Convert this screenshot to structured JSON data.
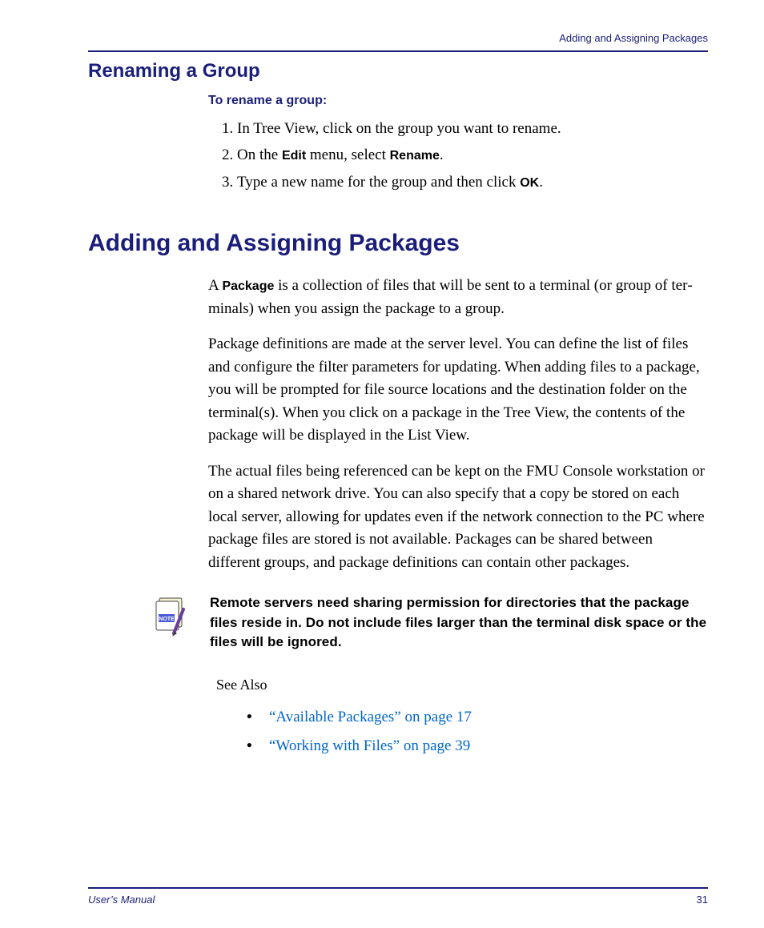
{
  "running_head": "Adding and Assigning Packages",
  "section1": {
    "title": "Renaming a Group",
    "procedure_head": "To rename a group:",
    "step1_pre": "In Tree View, click on the group you want to rename.",
    "step2_pre": "On the ",
    "step2_ui1": "Edit",
    "step2_mid": " menu, select ",
    "step2_ui2": "Rename",
    "step2_post": ".",
    "step3_pre": "Type a new name for the group and then click ",
    "step3_ui1": "OK",
    "step3_post": "."
  },
  "section2": {
    "title": "Adding and Assigning Packages",
    "p1_pre": "A ",
    "p1_ui": "Package",
    "p1_post": " is a collection of files that will be sent to a terminal (or group of ter­minals) when you assign the package to a group.",
    "p2": "Package definitions are made at the server level. You can define the list of files and configure the filter parameters for updating. When adding files to a pack­age, you will be prompted for file source locations and the destination folder on the terminal(s). When you click on a package in the Tree View, the con­tents of the package will be displayed in the List View.",
    "p3": "The actual files being referenced can be kept on the FMU Console worksta­tion or on a shared network drive. You can also specify that a copy be stored on each local server, allowing for updates even if the network connection to the PC where package files are stored is not available. Packages can be shared between different groups, and package definitions can contain other packages.",
    "note_label": "NOTE",
    "note": "Remote servers need sharing permission for directories that the package files reside in. Do not include files larger than the terminal disk space or the files will be ignored.",
    "see_also_head": "See Also",
    "see_also": [
      "“Available Packages” on page 17",
      "“Working with Files” on page 39"
    ]
  },
  "footer": {
    "left": "User’s Manual",
    "right": "31"
  }
}
